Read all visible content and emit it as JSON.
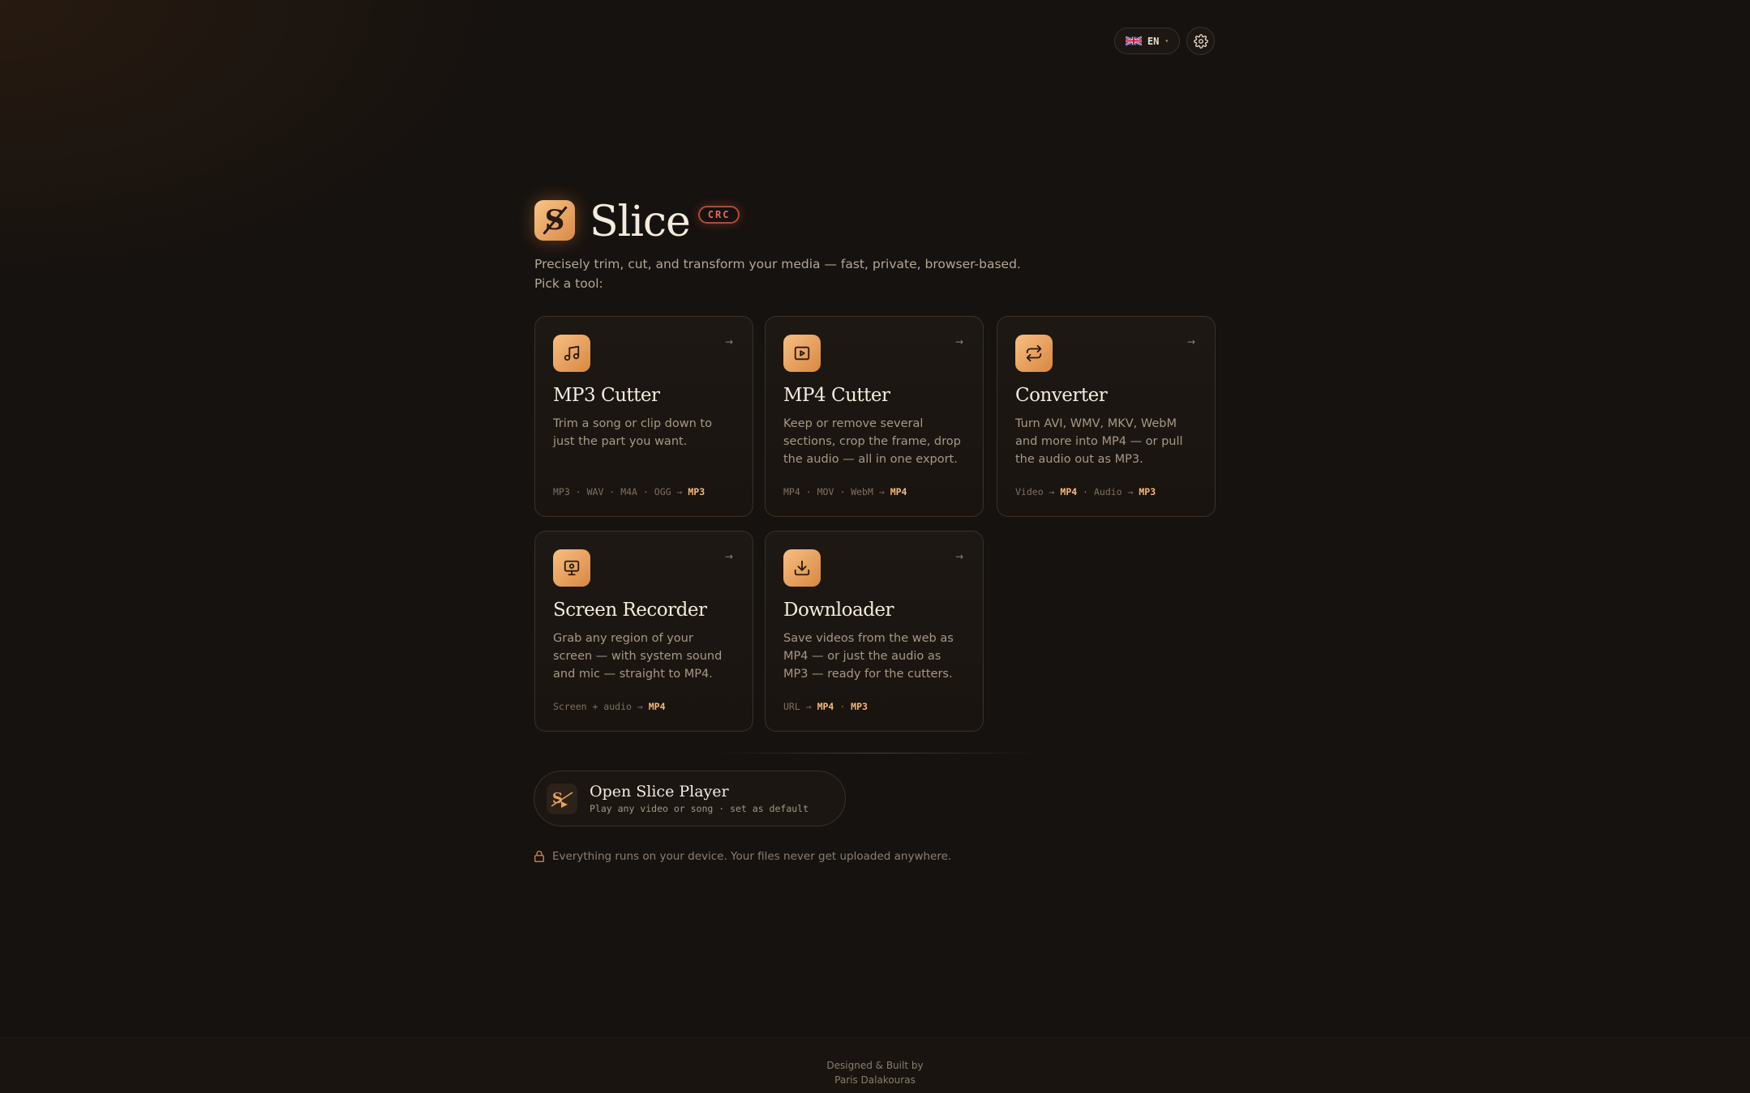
{
  "language": {
    "code": "EN"
  },
  "colors": {
    "accent": "#e9a25c",
    "badge": "#d9574a",
    "background": "#16120f"
  },
  "header": {
    "title": "Slice",
    "badge": "CRC",
    "tagline": "Precisely trim, cut, and transform your media — fast, private, browser-based.",
    "prompt": "Pick a tool:"
  },
  "tools": [
    {
      "icon": "music-note-icon",
      "title": "MP3 Cutter",
      "description": "Trim a song or clip down to just the part you want.",
      "formats": [
        "MP3",
        "·",
        "WAV",
        "·",
        "M4A",
        "·",
        "OGG",
        "→"
      ],
      "output": "MP3"
    },
    {
      "icon": "play-video-icon",
      "title": "MP4 Cutter",
      "description": "Keep or remove several sections, crop the frame, drop the audio — all in one export.",
      "formats": [
        "MP4",
        "·",
        "MOV",
        "·",
        "WebM",
        "→"
      ],
      "output": "MP4"
    },
    {
      "icon": "convert-arrows-icon",
      "title": "Converter",
      "description": "Turn AVI, WMV, MKV, WebM and more into MP4 — or pull the audio out as MP3.",
      "format_parts": [
        "Video →",
        "MP4",
        "· Audio →",
        "MP3"
      ]
    },
    {
      "icon": "screen-record-icon",
      "title": "Screen Recorder",
      "description": "Grab any region of your screen — with system sound and mic — straight to MP4.",
      "format_parts": [
        "Screen + audio →",
        "MP4"
      ]
    },
    {
      "icon": "download-icon",
      "title": "Downloader",
      "description": "Save videos from the web as MP4 — or just the audio as MP3 — ready for the cutters.",
      "format_parts": [
        "URL →",
        "MP4",
        "·",
        "MP3"
      ]
    }
  ],
  "player": {
    "title": "Open Slice Player",
    "subtitle": "Play any video or song · set as default"
  },
  "privacy_note": "Everything runs on your device. Your files never get uploaded anywhere.",
  "footer": {
    "line1": "Designed & Built by",
    "line2": "Paris Dalakouras"
  }
}
